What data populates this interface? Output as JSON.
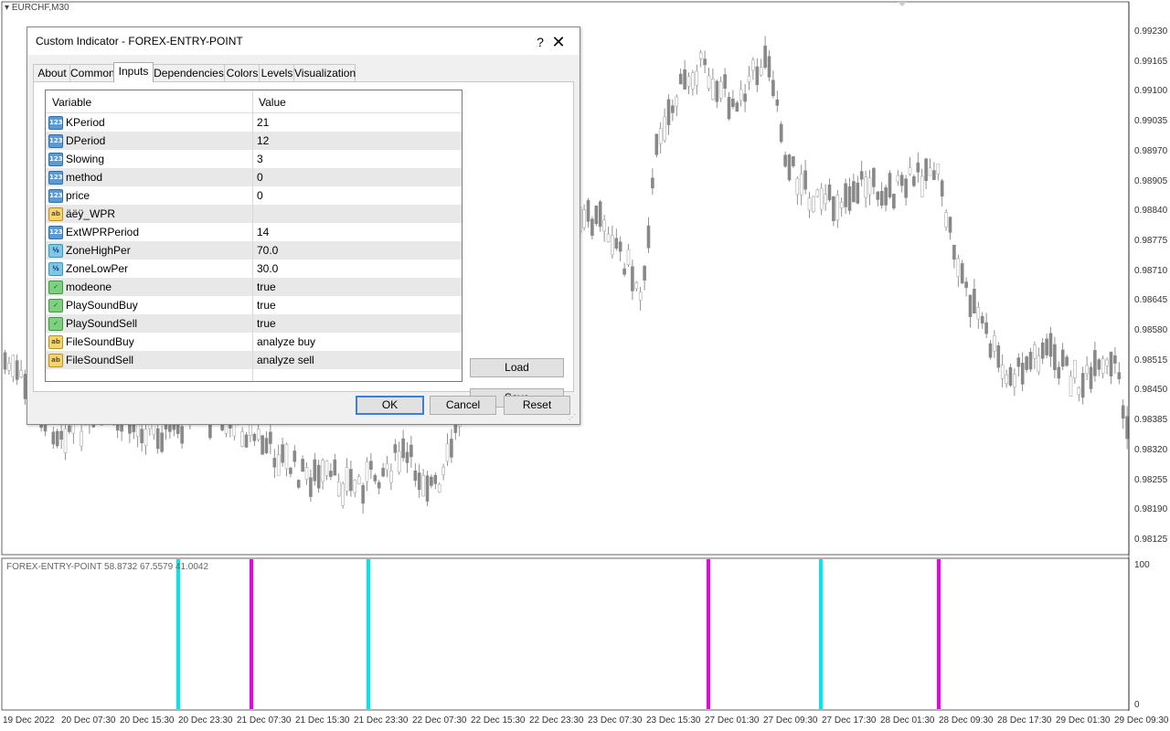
{
  "chart": {
    "symbol": "EURCHF,M30",
    "indicator_readout": "FOREX-ENTRY-POINT 58.8732 67.5579 41.0042",
    "price_axis": [
      "0.99230",
      "0.99165",
      "0.99100",
      "0.99035",
      "0.98970",
      "0.98905",
      "0.98840",
      "0.98775",
      "0.98710",
      "0.98645",
      "0.98580",
      "0.98515",
      "0.98450",
      "0.98385",
      "0.98320",
      "0.98255",
      "0.98190",
      "0.98125"
    ],
    "indicator_axis": [
      "100",
      "0"
    ],
    "time_axis": [
      "19 Dec 2022",
      "20 Dec 07:30",
      "20 Dec 15:30",
      "20 Dec 23:30",
      "21 Dec 07:30",
      "21 Dec 15:30",
      "21 Dec 23:30",
      "22 Dec 07:30",
      "22 Dec 15:30",
      "22 Dec 23:30",
      "23 Dec 07:30",
      "23 Dec 15:30",
      "27 Dec 01:30",
      "27 Dec 09:30",
      "27 Dec 17:30",
      "28 Dec 01:30",
      "28 Dec 09:30",
      "28 Dec 17:30",
      "29 Dec 01:30",
      "29 Dec 09:30"
    ],
    "signal_colors": {
      "buy": "#00e5ee",
      "sell": "#ee00ee"
    }
  },
  "dialog": {
    "title": "Custom Indicator - FOREX-ENTRY-POINT",
    "help_label": "?",
    "close_label": "✕",
    "tabs": [
      "About",
      "Common",
      "Inputs",
      "Dependencies",
      "Colors",
      "Levels",
      "Visualization"
    ],
    "active_tab": "Inputs",
    "grid": {
      "headers": {
        "variable": "Variable",
        "value": "Value"
      },
      "rows": [
        {
          "type": "int",
          "icon": "123",
          "name": "KPeriod",
          "value": "21"
        },
        {
          "type": "int",
          "icon": "123",
          "name": "DPeriod",
          "value": "12"
        },
        {
          "type": "int",
          "icon": "123",
          "name": "Slowing",
          "value": "3"
        },
        {
          "type": "int",
          "icon": "123",
          "name": "method",
          "value": "0"
        },
        {
          "type": "int",
          "icon": "123",
          "name": "price",
          "value": "0"
        },
        {
          "type": "str",
          "icon": "ab",
          "name": "äëÿ_WPR",
          "value": ""
        },
        {
          "type": "int",
          "icon": "123",
          "name": "ExtWPRPeriod",
          "value": "14"
        },
        {
          "type": "dbl",
          "icon": "½",
          "name": "ZoneHighPer",
          "value": "70.0"
        },
        {
          "type": "dbl",
          "icon": "½",
          "name": "ZoneLowPer",
          "value": "30.0"
        },
        {
          "type": "bool",
          "icon": "✓",
          "name": "modeone",
          "value": "true"
        },
        {
          "type": "bool",
          "icon": "✓",
          "name": "PlaySoundBuy",
          "value": "true"
        },
        {
          "type": "bool",
          "icon": "✓",
          "name": "PlaySoundSell",
          "value": "true"
        },
        {
          "type": "str",
          "icon": "ab",
          "name": "FileSoundBuy",
          "value": "analyze buy"
        },
        {
          "type": "str",
          "icon": "ab",
          "name": "FileSoundSell",
          "value": "analyze sell"
        }
      ]
    },
    "load_label": "Load",
    "save_label": "Save",
    "ok_label": "OK",
    "cancel_label": "Cancel",
    "reset_label": "Reset"
  }
}
